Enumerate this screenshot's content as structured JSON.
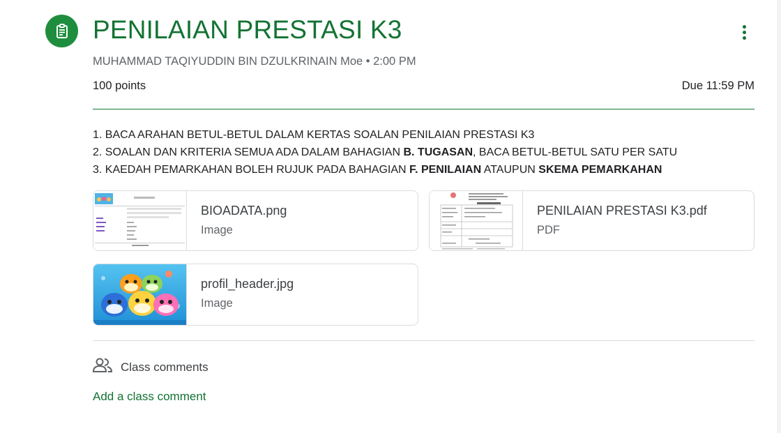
{
  "header": {
    "title": "PENILAIAN PRESTASI K3",
    "author_line": "MUHAMMAD TAQIYUDDIN BIN DZULKRINAIN Moe • 2:00 PM",
    "points": "100 points",
    "due": "Due 11:59 PM",
    "icon": "assignment-icon",
    "accent_color": "#137333"
  },
  "instructions": {
    "line1": "1. BACA ARAHAN BETUL-BETUL DALAM KERTAS SOALAN PENILAIAN PRESTASI K3",
    "line2_pre": "2. SOALAN DAN KRITERIA SEMUA ADA DALAM BAHAGIAN ",
    "line2_bold": "B. TUGASAN",
    "line2_post": ", BACA BETUL-BETUL SATU PER SATU",
    "line3_pre": "3. KAEDAH PEMARKAHAN BOLEH RUJUK PADA BAHAGIAN ",
    "line3_bold1": "F. PENILAIAN",
    "line3_mid": " ATAUPUN ",
    "line3_bold2": "SKEMA PEMARKAHAN"
  },
  "attachments": [
    {
      "name": "BIOADATA.png",
      "type": "Image"
    },
    {
      "name": "PENILAIAN PRESTASI K3.pdf",
      "type": "PDF"
    },
    {
      "name": "profil_header.jpg",
      "type": "Image"
    }
  ],
  "comments": {
    "label": "Class comments",
    "add_label": "Add a class comment",
    "icon": "people-icon"
  }
}
